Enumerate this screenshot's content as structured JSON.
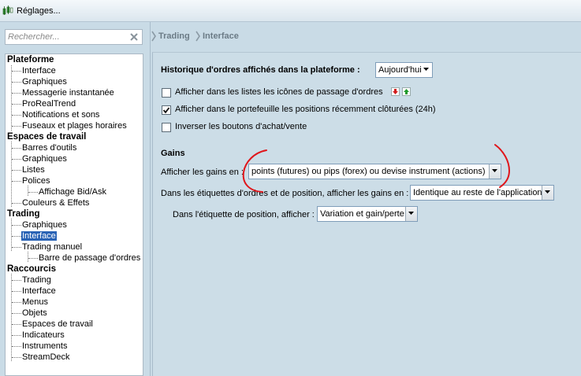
{
  "window": {
    "title": "Réglages..."
  },
  "search": {
    "placeholder": "Rechercher..."
  },
  "breadcrumb": {
    "items": [
      "Trading",
      "Interface"
    ]
  },
  "tree": {
    "plateforme": "Plateforme",
    "plateforme_items": [
      "Interface",
      "Graphiques",
      "Messagerie instantanée",
      "ProRealTrend",
      "Notifications et sons",
      "Fuseaux et plages horaires"
    ],
    "espaces": "Espaces de travail",
    "espaces_items": [
      "Barres d'outils",
      "Graphiques",
      "Listes",
      "Polices"
    ],
    "polices_child": "Affichage Bid/Ask",
    "couleurs": "Couleurs & Effets",
    "trading": "Trading",
    "trading_items": [
      "Graphiques",
      "Interface",
      "Trading manuel"
    ],
    "trading_manuel_child": "Barre de passage d'ordres",
    "raccourcis": "Raccourcis",
    "raccourcis_items": [
      "Trading",
      "Interface",
      "Menus",
      "Objets",
      "Espaces de travail",
      "Indicateurs",
      "Instruments",
      "StreamDeck"
    ],
    "selected": "Interface"
  },
  "panel": {
    "history_label": "Historique d'ordres affichés dans la plateforme :",
    "history_value": "Aujourd'hui",
    "cb1_label": "Afficher dans les listes les icônes de passage d'ordres",
    "cb1_checked": false,
    "cb2_label": "Afficher dans le portefeuille les positions récemment clôturées (24h)",
    "cb2_checked": true,
    "cb3_label": "Inverser les boutons d'achat/vente",
    "cb3_checked": false,
    "gains_title": "Gains",
    "gains_label": "Afficher les gains en :",
    "gains_value": "points (futures) ou pips (forex) ou devise instrument (actions)",
    "labels_label": "Dans les étiquettes d'ordres et de position, afficher les gains en :",
    "labels_value": "Identique au reste de l'application",
    "position_label": "Dans l'étiquette de position, afficher :",
    "position_value": "Variation et gain/perte"
  },
  "colors": {
    "selection": "#2a63b5",
    "annotation": "#e0161b",
    "panel_bg": "#ccdde7"
  }
}
